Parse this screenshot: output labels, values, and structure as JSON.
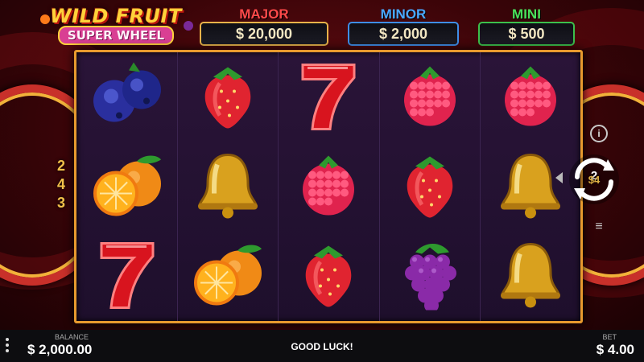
{
  "game": {
    "logo_line1": "WILD FRUIT",
    "logo_line2": "SUPER WHEEL"
  },
  "jackpots": [
    {
      "name": "MAJOR",
      "amount": "$ 20,000",
      "color": "#ff4a4a"
    },
    {
      "name": "MINOR",
      "amount": "$ 2,000",
      "color": "#4aa8ff"
    },
    {
      "name": "MINI",
      "amount": "$ 500",
      "color": "#4ae05a"
    }
  ],
  "wheel": {
    "multipliers": [
      "2",
      "4",
      "3"
    ]
  },
  "reels": {
    "rows": [
      [
        "blueberries-icon",
        "strawberry-icon",
        "seven-icon",
        "raspberry-icon",
        "raspberry-icon"
      ],
      [
        "orange-icon",
        "bell-icon",
        "raspberry-icon",
        "strawberry-icon",
        "bell-icon"
      ],
      [
        "seven-icon",
        "orange-icon",
        "strawberry-icon",
        "grapes-icon",
        "bell-icon"
      ]
    ]
  },
  "controls": {
    "autoplay_top": "2",
    "autoplay_value": "$4",
    "info_icon": "info-icon",
    "menu_icon": "hamburger-icon"
  },
  "bottom_bar": {
    "balance_label": "BALANCE",
    "balance_value": "$ 2,000.00",
    "message": "GOOD LUCK!",
    "bet_label": "BET",
    "bet_value": "$ 4.00"
  },
  "colors": {
    "frame_border": "#e89a2e",
    "reel_bg": "#2a1438",
    "background": "#6b0d12"
  }
}
